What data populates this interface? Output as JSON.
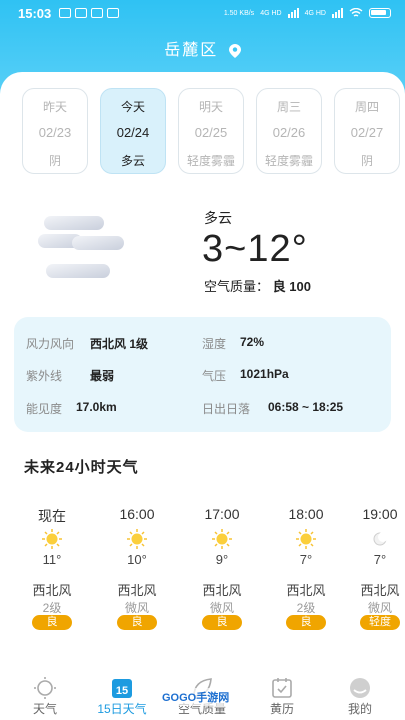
{
  "status_bar": {
    "time": "15:03",
    "net1": "4G HD",
    "net2": "4G HD",
    "speed": "1.50 KB/s"
  },
  "header": {
    "city": "岳麓区"
  },
  "days": [
    {
      "name": "昨天",
      "date": "02/23",
      "cond": "阴",
      "active": false
    },
    {
      "name": "今天",
      "date": "02/24",
      "cond": "多云",
      "active": true
    },
    {
      "name": "明天",
      "date": "02/25",
      "cond": "轻度雾霾",
      "active": false
    },
    {
      "name": "周三",
      "date": "02/26",
      "cond": "轻度雾霾",
      "active": false
    },
    {
      "name": "周四",
      "date": "02/27",
      "cond": "阴",
      "active": false
    }
  ],
  "current": {
    "condition": "多云",
    "temp": "3~12°",
    "aqi_label": "空气质量：",
    "aqi_value": "良 100"
  },
  "details": {
    "wind_label": "风力风向",
    "wind_value": "西北风 1级",
    "humidity_label": "湿度",
    "humidity_value": "72%",
    "uv_label": "紫外线",
    "uv_value": "最弱",
    "pressure_label": "气压",
    "pressure_value": "1021hPa",
    "visibility_label": "能见度",
    "visibility_value": "17.0km",
    "sun_label": "日出日落",
    "sun_value": "06:58 ~ 18:25"
  },
  "hourly_title": "未来24小时天气",
  "hourly": [
    {
      "time": "现在",
      "temp": "11°",
      "wind": "西北风",
      "level": "2级",
      "aqi": "良",
      "icon": "sun-icon"
    },
    {
      "time": "16:00",
      "temp": "10°",
      "wind": "西北风",
      "level": "微风",
      "aqi": "良",
      "icon": "sun-icon"
    },
    {
      "time": "17:00",
      "temp": "9°",
      "wind": "西北风",
      "level": "微风",
      "aqi": "良",
      "icon": "sun-icon"
    },
    {
      "time": "18:00",
      "temp": "7°",
      "wind": "西北风",
      "level": "2级",
      "aqi": "良",
      "icon": "sun-icon"
    },
    {
      "time": "19:00",
      "temp": "7°",
      "wind": "西北风",
      "level": "微风",
      "aqi": "轻度",
      "icon": "moon-icon"
    }
  ],
  "nav": [
    {
      "label": "天气",
      "icon": "weather-icon",
      "active": false
    },
    {
      "label": "15日天气",
      "icon": "calendar-15-icon",
      "active": true
    },
    {
      "label": "空气质量",
      "icon": "leaf-icon",
      "active": false
    },
    {
      "label": "黄历",
      "icon": "almanac-icon",
      "active": false
    },
    {
      "label": "我的",
      "icon": "profile-icon",
      "active": false
    }
  ],
  "watermark": "GOGO手游网",
  "colors": {
    "accent": "#2fc2f3",
    "badge": "#f0a500",
    "active_nav": "#1d9be0"
  }
}
